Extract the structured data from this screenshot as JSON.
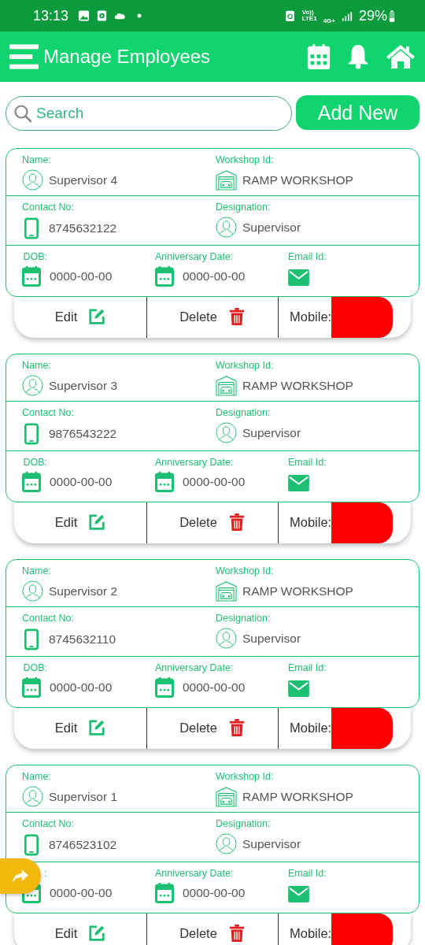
{
  "status_bar": {
    "time": "13:13",
    "volte": "Vo))",
    "lte": "LTE1",
    "network": "4G+",
    "battery": "29%"
  },
  "header": {
    "title": "Manage Employees"
  },
  "search": {
    "placeholder": "Search"
  },
  "add_button": "Add New",
  "employees": [
    {
      "name_label": "Name:",
      "name": "Supervisor 4",
      "workshop_label": "Workshop Id:",
      "workshop": "RAMP WORKSHOP",
      "contact_label": "Contact No:",
      "contact": "8745632122",
      "designation_label": "Designation:",
      "designation": "Supervisor",
      "dob_label": "DOB:",
      "dob": "0000-00-00",
      "anniversary_label": "Anniversary Date:",
      "anniversary": "0000-00-00",
      "email_label": "Email Id:",
      "edit": "Edit",
      "delete": "Delete",
      "mobile_label": "Mobile:"
    },
    {
      "name_label": "Name:",
      "name": "Supervisor 3",
      "workshop_label": "Workshop Id:",
      "workshop": "RAMP WORKSHOP",
      "contact_label": "Contact No:",
      "contact": "9876543222",
      "designation_label": "Designation:",
      "designation": "Supervisor",
      "dob_label": "DOB:",
      "dob": "0000-00-00",
      "anniversary_label": "Anniversary Date:",
      "anniversary": "0000-00-00",
      "email_label": "Email Id:",
      "edit": "Edit",
      "delete": "Delete",
      "mobile_label": "Mobile:"
    },
    {
      "name_label": "Name:",
      "name": "Supervisor 2",
      "workshop_label": "Workshop Id:",
      "workshop": "RAMP WORKSHOP",
      "contact_label": "Contact No:",
      "contact": "8745632110",
      "designation_label": "Designation:",
      "designation": "Supervisor",
      "dob_label": "DOB:",
      "dob": "0000-00-00",
      "anniversary_label": "Anniversary Date:",
      "anniversary": "0000-00-00",
      "email_label": "Email Id:",
      "edit": "Edit",
      "delete": "Delete",
      "mobile_label": "Mobile:"
    },
    {
      "name_label": "Name:",
      "name": "Supervisor 1",
      "workshop_label": "Workshop Id:",
      "workshop": "RAMP WORKSHOP",
      "contact_label": "Contact No:",
      "contact": "8746523102",
      "designation_label": "Designation:",
      "designation": "Supervisor",
      "dob_label": ":",
      "dob": "0000-00-00",
      "anniversary_label": "Anniversary Date:",
      "anniversary": "0000-00-00",
      "email_label": "Email Id:",
      "edit": "Edit",
      "delete": "Delete",
      "mobile_label": "Mobile:"
    }
  ]
}
